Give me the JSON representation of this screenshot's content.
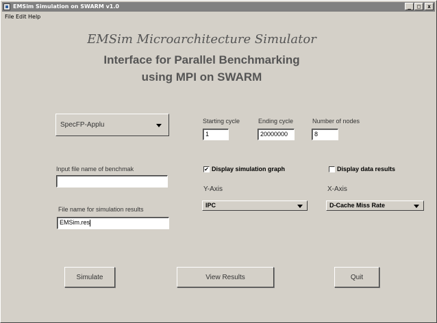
{
  "window": {
    "title": "EMSim Simulation on SWARM v1.0",
    "min_glyph": "_",
    "max_glyph": "□",
    "close_glyph": "x"
  },
  "menu": [
    "File",
    "Edit",
    "Help"
  ],
  "header": {
    "title": "EMSim Microarchitecture Simulator",
    "subtitle_line1": "Interface for Parallel Benchmarking",
    "subtitle_line2": "using MPI on SWARM"
  },
  "benchmark_select": {
    "value": "SpecFP-Applu"
  },
  "cycles": {
    "start_label": "Starting cycle",
    "start_value": "1",
    "end_label": "Ending cycle",
    "end_value": "20000000",
    "nodes_label": "Number of nodes",
    "nodes_value": "8"
  },
  "input_file": {
    "label": "Input file name of benchmak",
    "value": ""
  },
  "results_file": {
    "label": "File name for simulation results",
    "value": "EMSim.res"
  },
  "options": {
    "display_graph": {
      "label": "Display simulation graph",
      "checked": true
    },
    "display_data": {
      "label": "Display data results",
      "checked": false
    }
  },
  "y_axis": {
    "label": "Y-Axis",
    "value": "IPC"
  },
  "x_axis": {
    "label": "X-Axis",
    "value": "D-Cache Miss Rate"
  },
  "buttons": {
    "simulate": "Simulate",
    "view_results": "View Results",
    "quit": "Quit"
  },
  "colors": {
    "background": "#d4d0c8",
    "title_bar": "#808080",
    "heading_text": "#555555"
  }
}
